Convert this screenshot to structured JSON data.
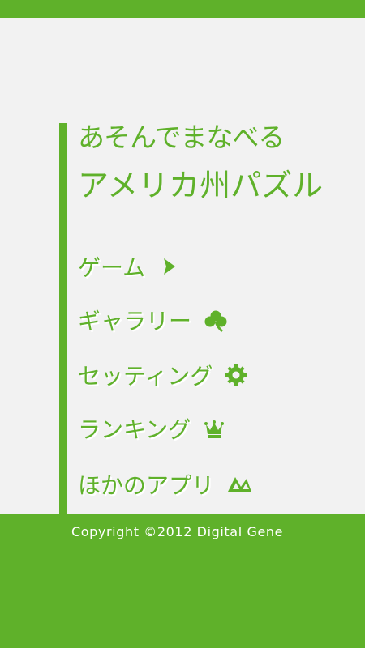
{
  "app": {
    "subtitle": "あそんでまなべる",
    "title": "アメリカ州パズル"
  },
  "menu": [
    {
      "label": "ゲーム",
      "icon": "arrow-right-icon"
    },
    {
      "label": "ギャラリー",
      "icon": "clover-icon"
    },
    {
      "label": "セッティング",
      "icon": "gear-icon"
    },
    {
      "label": "ランキング",
      "icon": "crown-icon"
    },
    {
      "label": "ほかのアプリ",
      "icon": "apps-icon"
    }
  ],
  "footer": {
    "copyright": "Copyright  ©2012 Digital Gene"
  },
  "colors": {
    "accent": "#5fb12a",
    "background": "#f2f2f2",
    "footer_text": "#ffffff"
  }
}
